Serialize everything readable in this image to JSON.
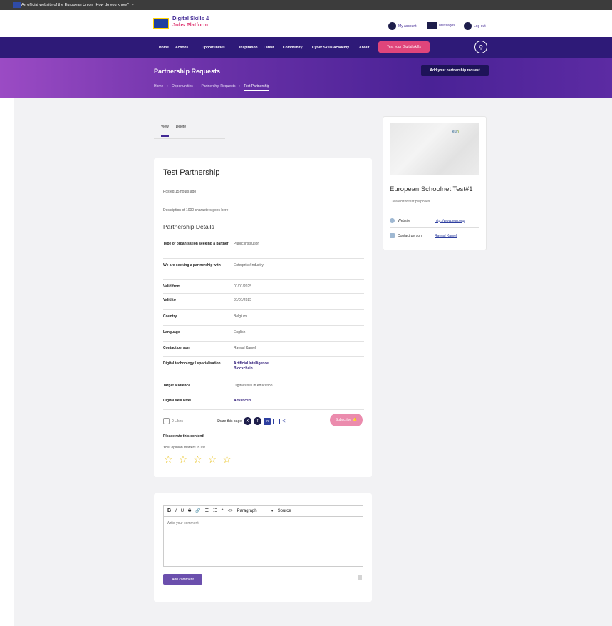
{
  "eu_bar": {
    "text": "An official website of the European Union",
    "link": "How do you know?"
  },
  "header": {
    "logo_line1": "Digital Skills &",
    "logo_line2": "Jobs Platform",
    "my_account": "My account",
    "messages": "Messages",
    "logout": "Log out"
  },
  "nav": {
    "items": [
      "Home",
      "Actions",
      "Opportunities",
      "Inspiration",
      "Latest",
      "Community",
      "Cyber Skills Academy",
      "About"
    ],
    "cta": "Test your Digital skills",
    "search_icon": "search-icon"
  },
  "hero": {
    "title": "Partnership Requests",
    "breadcrumbs": [
      "Home",
      "Opportunities",
      "Partnership Requests",
      "Test Partnership"
    ],
    "button": "Add your partnership request"
  },
  "tabs": [
    "View",
    "Delete"
  ],
  "main": {
    "title": "Test Partnership",
    "posted": "Posted 15 hours ago",
    "description": "Description of 1000 characters goes here",
    "details_title": "Partnership Details",
    "details": [
      {
        "key": "Type of organisation seeking a partner",
        "value": "Public institution"
      },
      {
        "key": "We are seeking a partnership with",
        "value": "Enterprise/Industry"
      },
      {
        "key": "Valid from",
        "value": "01/01/2025"
      },
      {
        "key": "Valid to",
        "value": "31/01/2025"
      },
      {
        "key": "Country",
        "value": "Belgium"
      },
      {
        "key": "Language",
        "value": "English"
      },
      {
        "key": "Contact person",
        "value": "Rawad Kamel"
      },
      {
        "key": "Digital technology / specialisation",
        "value": "Artificial Intelligence",
        "value2": "Blockchain"
      },
      {
        "key": "Target audience",
        "value": "Digital skills in education"
      },
      {
        "key": "Digital skill level",
        "value": "Advanced"
      }
    ],
    "likes": "0 Likes",
    "share_label": "Share this page",
    "subscribe": "Subscribe",
    "rate_title": "Please rate this content!",
    "rate_sub": "Your opinion matters to us!",
    "rating": 0,
    "stars": "☆☆☆☆☆"
  },
  "sidebar": {
    "org_name": "European Schoolnet Test#1",
    "org_desc": "Created for test purposes",
    "website_label": "Website",
    "website_value": "http://www.eun.org/",
    "contact_label": "Contact person",
    "contact_value": "Rawad Kamel"
  },
  "comment": {
    "toolbar": [
      "B",
      "I",
      "U",
      "S",
      "🔗",
      "☰",
      "☷",
      "❝",
      "<>",
      "Paragraph",
      "Source"
    ],
    "placeholder": "Write your comment",
    "add_button": "Add comment"
  },
  "colors": {
    "primary": "#2e1a78",
    "accent": "#e0457b",
    "background": "#f2f2f4"
  }
}
